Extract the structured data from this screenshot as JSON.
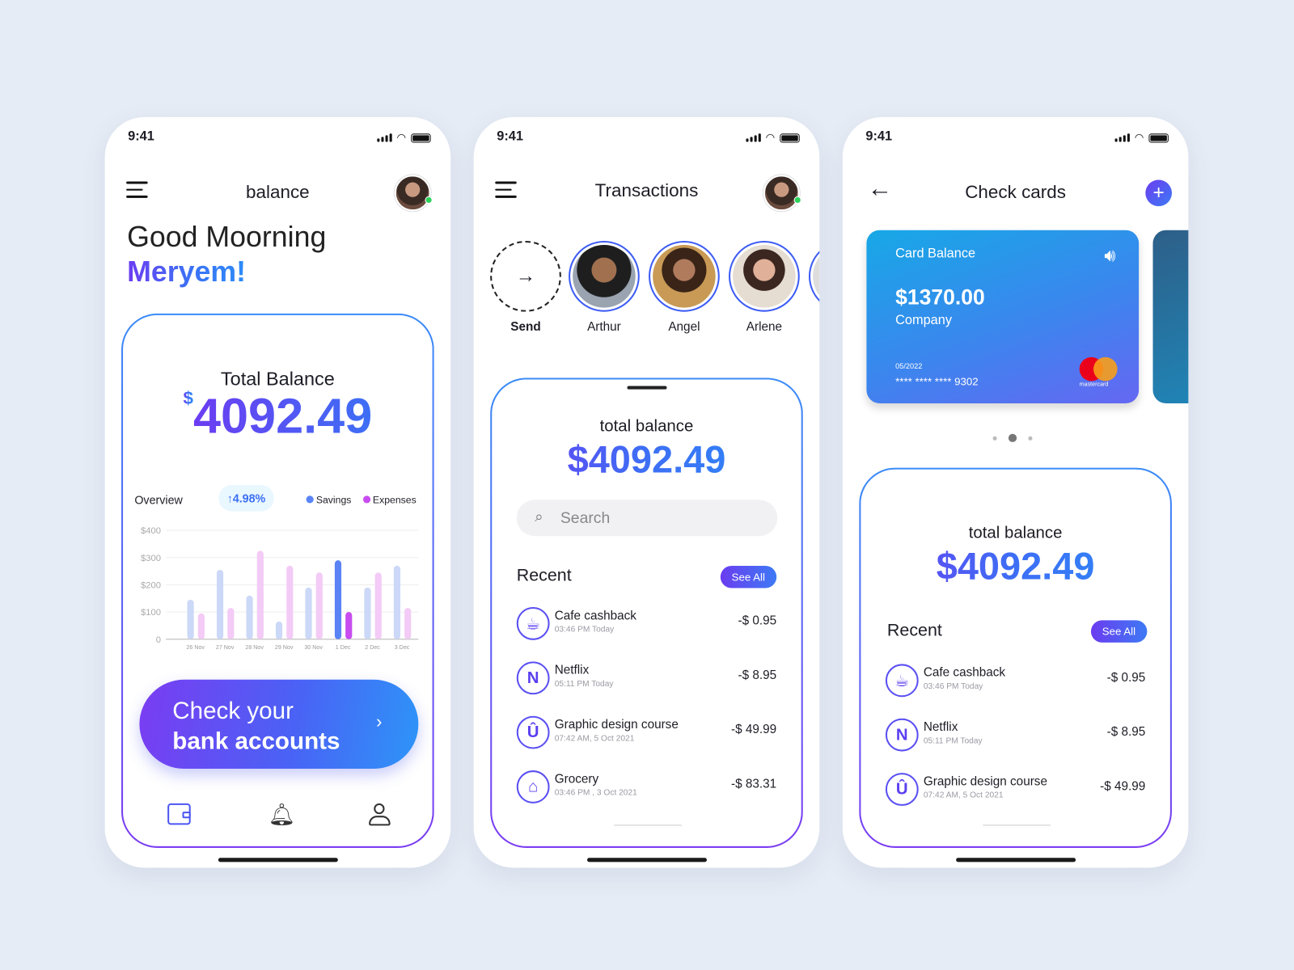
{
  "status_time": "9:41",
  "colors": {
    "accent_purple": "#6c3cf2",
    "accent_blue": "#2c8cf8",
    "savings": "#5a83f5",
    "expenses": "#c84cf0",
    "background": "#e6ecf5"
  },
  "balance_screen": {
    "title": "balance",
    "greeting": "Good Moorning",
    "name": "Meryem!",
    "total_label": "Total Balance",
    "currency": "$",
    "total_value": "4092.49",
    "overview_label": "Overview",
    "change": "4.98%",
    "legend": [
      "Savings",
      "Expenses"
    ],
    "cta_line1": "Check your",
    "cta_line2": "bank accounts",
    "nav": [
      "wallet-icon",
      "bell-icon",
      "user-icon"
    ]
  },
  "chart_data": {
    "type": "bar",
    "categories": [
      "26 Nov",
      "27 Nov",
      "28 Nov",
      "29 Nov",
      "30 Nov",
      "1 Dec",
      "2 Dec",
      "3 Dec"
    ],
    "series": [
      {
        "name": "Savings",
        "values": [
          145,
          255,
          160,
          65,
          190,
          290,
          190,
          270
        ]
      },
      {
        "name": "Expenses",
        "values": [
          95,
          115,
          325,
          270,
          245,
          100,
          245,
          115
        ]
      }
    ],
    "ylim": [
      0,
      400
    ],
    "yticks": [
      "0",
      "$100",
      "$200",
      "$300",
      "$400"
    ],
    "highlighted_category": "1 Dec",
    "grid": true,
    "legend_placement": "top-right"
  },
  "transactions_screen": {
    "title": "Transactions",
    "contacts": [
      {
        "name": "Send"
      },
      {
        "name": "Arthur"
      },
      {
        "name": "Angel"
      },
      {
        "name": "Arlene"
      }
    ],
    "total_label": "total balance",
    "total_value": "$4092.49",
    "search_placeholder": "Search",
    "recent_label": "Recent",
    "see_all": "See All",
    "items": [
      {
        "name": "Cafe cashback",
        "time": "03:46 PM  Today",
        "amount": "-$ 0.95",
        "icon": "coffee-cup-icon"
      },
      {
        "name": "Netflix",
        "time": "05:11 PM  Today",
        "amount": "-$ 8.95",
        "icon": "netflix-icon"
      },
      {
        "name": "Graphic design course",
        "time": "07:42 AM, 5 Oct 2021",
        "amount": "-$ 49.99",
        "icon": "udemy-icon"
      },
      {
        "name": "Grocery",
        "time": "03:46 PM , 3 Oct 2021",
        "amount": "-$ 83.31",
        "icon": "basket-icon"
      }
    ]
  },
  "cards_screen": {
    "title": "Check cards",
    "card": {
      "label": "Card Balance",
      "amount": "$1370.00",
      "type": "Company",
      "expiry": "05/2022",
      "number": "**** **** **** 9302",
      "brand": "mastercard"
    },
    "carousel_active": 1,
    "carousel_count": 3,
    "total_label": "total balance",
    "total_value": "$4092.49",
    "recent_label": "Recent",
    "see_all": "See All",
    "items": [
      {
        "name": "Cafe cashback",
        "time": "03:46 PM  Today",
        "amount": "-$ 0.95"
      },
      {
        "name": "Netflix",
        "time": "05:11 PM  Today",
        "amount": "-$ 8.95"
      },
      {
        "name": "Graphic design course",
        "time": "07:42 AM, 5 Oct 2021",
        "amount": "-$ 49.99"
      }
    ]
  }
}
